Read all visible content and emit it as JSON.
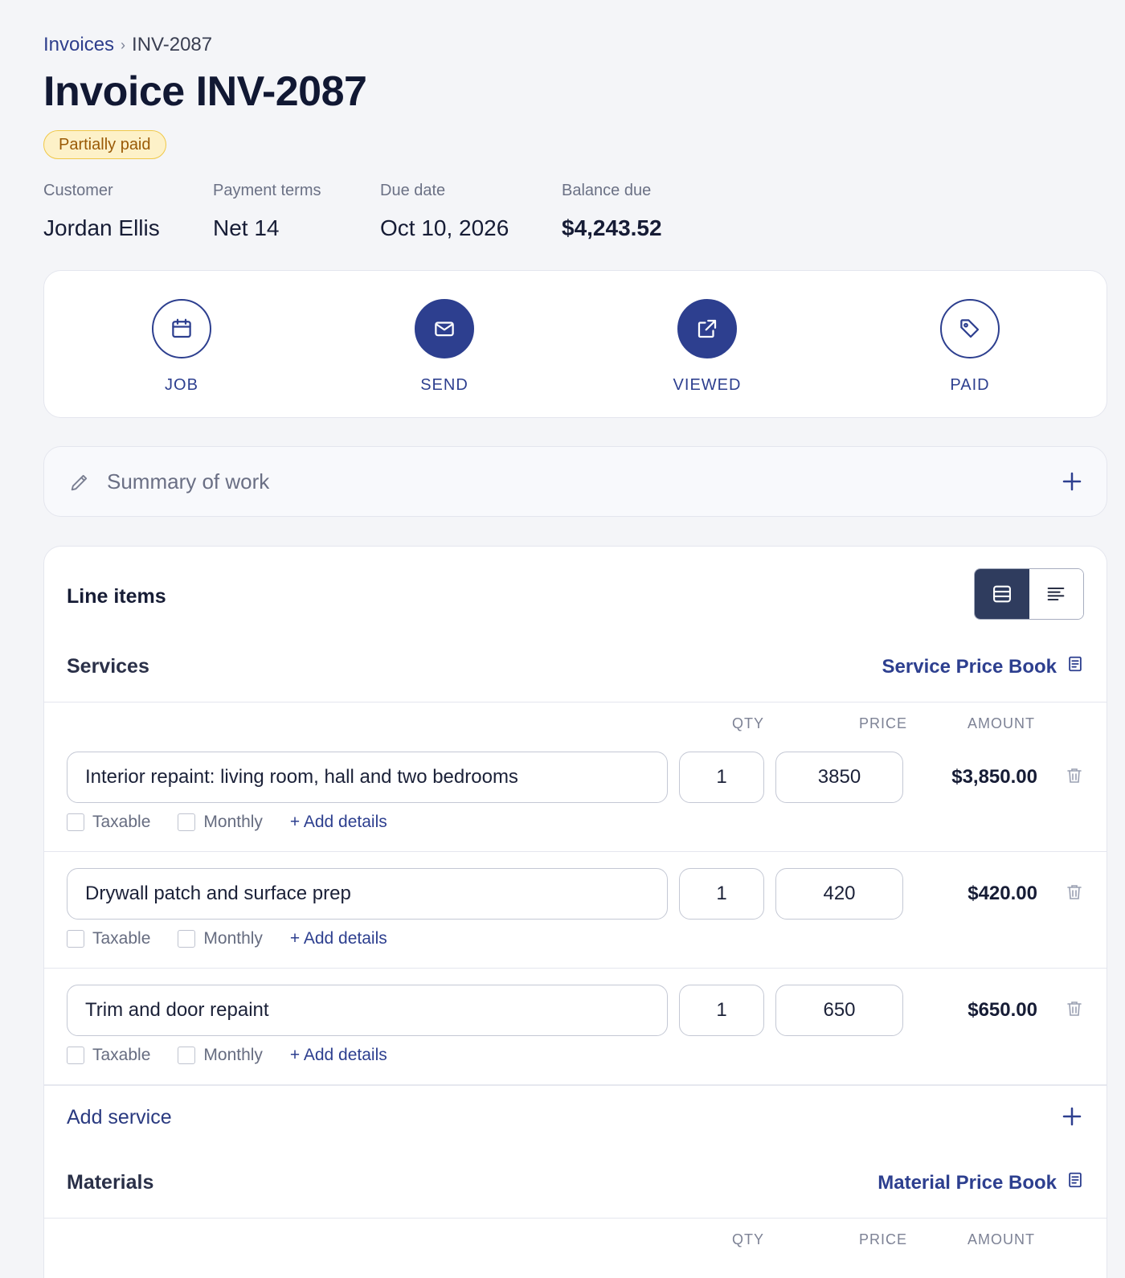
{
  "breadcrumb": {
    "parent": "Invoices",
    "separator": "›",
    "current": "INV-2087"
  },
  "page_title": "Invoice INV-2087",
  "status": {
    "label": "Partially paid",
    "color": "#9a5a06",
    "background": "#fdf1c8"
  },
  "meta": [
    {
      "label": "Customer",
      "value": "Jordan Ellis"
    },
    {
      "label": "Payment terms",
      "value": "Net 14"
    },
    {
      "label": "Due date",
      "value": "Oct 10, 2026"
    },
    {
      "label": "Balance due",
      "value": "$4,243.52"
    }
  ],
  "steps": [
    {
      "label": "JOB",
      "icon": "calendar-icon",
      "filled": false
    },
    {
      "label": "SEND",
      "icon": "mail-icon",
      "filled": true
    },
    {
      "label": "VIEWED",
      "icon": "external-link-icon",
      "filled": true
    },
    {
      "label": "PAID",
      "icon": "tag-icon",
      "filled": false
    }
  ],
  "summary": {
    "placeholder": "Summary of work"
  },
  "line_items": {
    "title": "Line items",
    "view_toggle": {
      "active": "card-view",
      "options": [
        "card-view-icon",
        "list-view-icon"
      ]
    },
    "services": {
      "title": "Services",
      "price_book": "Service Price Book",
      "columns": {
        "qty": "QTY",
        "price": "PRICE",
        "amount": "AMOUNT"
      },
      "rows": [
        {
          "description": "Interior repaint: living room, hall and two bedrooms",
          "qty": "1",
          "price": "3850",
          "amount": "$3,850.00"
        },
        {
          "description": "Drywall patch and surface prep",
          "qty": "1",
          "price": "420",
          "amount": "$420.00"
        },
        {
          "description": "Trim and door repaint",
          "qty": "1",
          "price": "650",
          "amount": "$650.00"
        }
      ],
      "taxable_label": "Taxable",
      "monthly_label": "Monthly",
      "add_details_label": "+ Add details",
      "add_label": "Add service"
    },
    "materials": {
      "title": "Materials",
      "price_book": "Material Price Book",
      "columns": {
        "qty": "QTY",
        "price": "PRICE",
        "amount": "AMOUNT"
      }
    }
  },
  "colors": {
    "accent": "#2d3f8f",
    "background": "#f4f5f8",
    "card": "#ffffff"
  }
}
